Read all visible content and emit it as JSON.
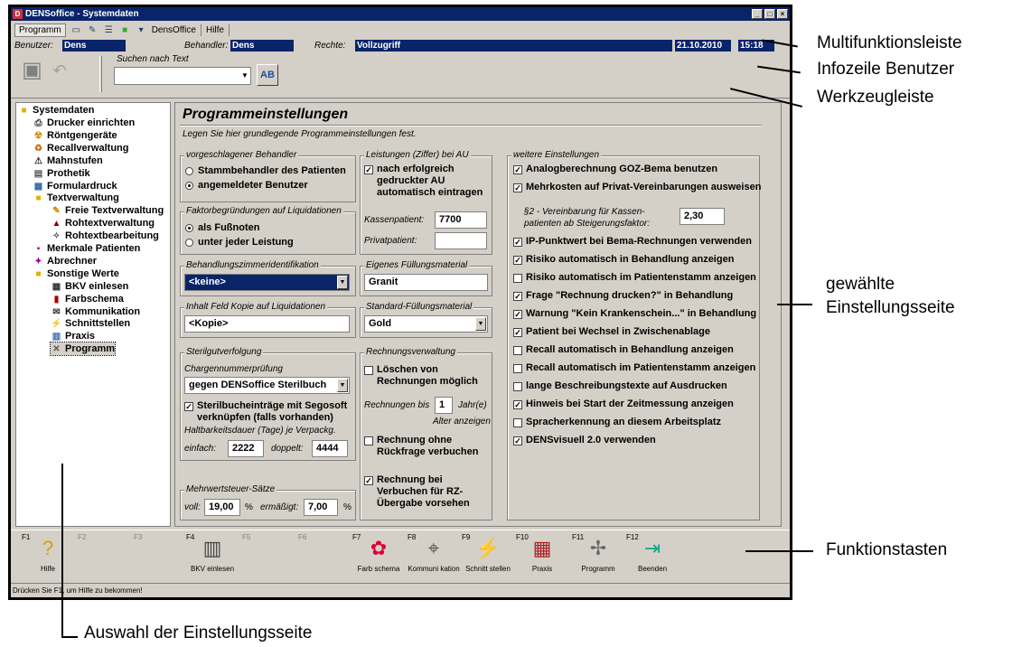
{
  "window": {
    "title": "DENSoffice - Systemdaten",
    "min": "_",
    "max": "□",
    "close": "×"
  },
  "menubar": {
    "program_button": "Programm",
    "items": [
      "DensOffice",
      "Hilfe"
    ]
  },
  "infobar": {
    "user_label": "Benutzer:",
    "user_value": "Dens",
    "practitioner_label": "Behandler:",
    "practitioner_value": "Dens",
    "rights_label": "Rechte:",
    "rights_value": "Vollzugriff",
    "date": "21.10.2010",
    "time": "15:18",
    "accent": "#0a246a"
  },
  "toolbar": {
    "search_label": "Suchen nach Text",
    "search_value": ""
  },
  "tree": {
    "root": "Systemdaten",
    "items": [
      "Drucker einrichten",
      "Röntgengeräte",
      "Recallverwaltung",
      "Mahnstufen",
      "Prothetik",
      "Formulardruck",
      "Textverwaltung",
      "Freie Textverwaltung",
      "Rohtextverwaltung",
      "Rohtextbearbeitung",
      "Merkmale Patienten",
      "Abrechner",
      "Sonstige Werte",
      "BKV einlesen",
      "Farbschema",
      "Kommunikation",
      "Schnittstellen",
      "Praxis",
      "Programm"
    ]
  },
  "page": {
    "title": "Programmeinstellungen",
    "description": "Legen Sie hier grundlegende Programmeinstellungen fest.",
    "behandler": {
      "label": "vorgeschlagener Behandler",
      "opt1": "Stammbehandler des Patienten",
      "opt2": "angemeldeter Benutzer"
    },
    "leistungen": {
      "label": "Leistungen (Ziffer) bei AU",
      "check": "nach erfolgreich gedruckter AU automatisch eintragen",
      "kassen_label": "Kassenpatient:",
      "kassen_value": "7700",
      "privat_label": "Privatpatient:",
      "privat_value": ""
    },
    "faktor": {
      "label": "Faktorbegründungen auf Liquidationen",
      "opt1": "als Fußnoten",
      "opt2": "unter jeder Leistung"
    },
    "zimmer": {
      "label": "Behandlungszimmeridentifikation",
      "value": "<keine>"
    },
    "fuellung": {
      "label": "Eigenes Füllungsmaterial",
      "value": "Granit"
    },
    "kopie": {
      "label": "Inhalt Feld Kopie auf Liquidationen",
      "value": "<Kopie>"
    },
    "std_fuellung": {
      "label": "Standard-Füllungsmaterial",
      "value": "Gold"
    },
    "steril": {
      "label": "Sterilgutverfolgung",
      "charge_label": "Chargennummerprüfung",
      "charge_value": "gegen DENSoffice Sterilbuch",
      "check": "Sterilbucheinträge mit Segosoft verknüpfen (falls vorhanden)",
      "halt_label": "Haltbarkeitsdauer (Tage) je Verpackg.",
      "einfach_label": "einfach:",
      "einfach_value": "2222",
      "doppelt_label": "doppelt:",
      "doppelt_value": "4444"
    },
    "rechnung": {
      "label": "Rechnungsverwaltung",
      "loeschen": "Löschen von Rechnungen möglich",
      "bis_label": "Rechnungen bis",
      "bis_value": "1",
      "jahr": "Jahr(e)",
      "alter": "Alter anzeigen",
      "ohne": "Rechnung ohne Rückfrage verbuchen",
      "bei": "Rechnung bei Verbuchen für RZ-Übergabe vorsehen"
    },
    "mwst": {
      "label": "Mehrwertsteuer-Sätze",
      "voll_label": "voll:",
      "voll_value": "19,00",
      "pct": "%",
      "erm_label": "ermäßigt:",
      "erm_value": "7,00"
    },
    "weitere": {
      "label": "weitere Einstellungen",
      "f0": "2,30",
      "vereinbarung": "§2 - Vereinbarung für Kassen-patienten ab Steigerungsfaktor:",
      "items": [
        {
          "label": "Analogberechnung GOZ-Bema benutzen",
          "checked": "☑"
        },
        {
          "label": "Mehrkosten auf Privat-Vereinbarungen ausweisen",
          "checked": "☑"
        },
        {
          "label": "IP-Punktwert bei Bema-Rechnungen verwenden",
          "checked": "☑"
        },
        {
          "label": "Risiko automatisch in Behandlung anzeigen",
          "checked": "☑"
        },
        {
          "label": "Risiko automatisch im Patientenstamm anzeigen",
          "checked": "☐"
        },
        {
          "label": "Frage \"Rechnung drucken?\" in Behandlung",
          "checked": "☑"
        },
        {
          "label": "Warnung \"Kein Krankenschein...\" in Behandlung",
          "checked": "☑"
        },
        {
          "label": "Patient bei Wechsel in Zwischenablage",
          "checked": "☑"
        },
        {
          "label": "Recall automatisch in Behandlung anzeigen",
          "checked": "☐"
        },
        {
          "label": "Recall automatisch im Patientenstamm anzeigen",
          "checked": "☐"
        },
        {
          "label": "lange Beschreibungstexte auf Ausdrucken",
          "checked": "☐"
        },
        {
          "label": "Hinweis bei Start der Zeitmessung anzeigen",
          "checked": "☑"
        },
        {
          "label": "Spracherkennung an diesem Arbeitsplatz",
          "checked": "☐"
        },
        {
          "label": "DENSvisuell 2.0 verwenden",
          "checked": "☑"
        }
      ]
    }
  },
  "fkeys": [
    {
      "key": "F1",
      "label": "Hilfe",
      "icon": "help-icon"
    },
    {
      "key": "F2",
      "label": ""
    },
    {
      "key": "F3",
      "label": ""
    },
    {
      "key": "F4",
      "label": "BKV einlesen",
      "icon": "book-icon"
    },
    {
      "key": "F5",
      "label": ""
    },
    {
      "key": "F6",
      "label": ""
    },
    {
      "key": "F7",
      "label": "Farb schema",
      "icon": "palette-icon"
    },
    {
      "key": "F8",
      "label": "Kommuni kation",
      "icon": "satellite-icon"
    },
    {
      "key": "F9",
      "label": "Schnitt stellen",
      "icon": "plug-icon"
    },
    {
      "key": "F10",
      "label": "Praxis",
      "icon": "building-icon"
    },
    {
      "key": "F11",
      "label": "Programm",
      "icon": "grid-icon"
    },
    {
      "key": "F12",
      "label": "Beenden",
      "icon": "exit-icon"
    }
  ],
  "status": "Drücken Sie F1, um Hilfe zu bekommen!",
  "callouts": {
    "multi": "Multifunktionsleiste",
    "info": "Infozeile Benutzer",
    "werkzeug": "Werkzeugleiste",
    "einstellung1": "gewählte",
    "einstellung2": "Einstellungsseite",
    "fkeys": "Funktionstasten",
    "auswahl": "Auswahl der Einstellungsseite"
  }
}
